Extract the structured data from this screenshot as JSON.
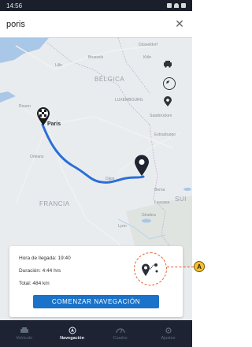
{
  "status_bar": {
    "time": "14:56"
  },
  "search": {
    "value": "poris",
    "close_icon": "close-icon"
  },
  "map": {
    "labels": {
      "dusseldorf": "Düsseldorf",
      "brussels": "Brussels",
      "koln": "Köln",
      "lille": "Lille",
      "belgica": "BÉLGICA",
      "luxembourg": "LUXEMBOURG",
      "saarbrucken": "Saarbrücken",
      "rouen": "Rouen",
      "paris": "Paris",
      "strasbourg": "Estrasburgo",
      "orleans": "Orléans",
      "dijon": "Dijon",
      "bern": "Berna",
      "francia": "FRANCIA",
      "lausanne": "Lausana",
      "geneva": "Ginebra",
      "lyon": "Lyon",
      "sui": "SUI"
    },
    "controls": [
      "car-icon",
      "compass-icon",
      "pin-icon"
    ]
  },
  "info_card": {
    "arrival": "Hora de llegada: 19:40",
    "duration": "Duración: 4:44 hrs",
    "total": "Total: 484 km",
    "start_button": "COMENZAR NAVEGACIÓN"
  },
  "bottom_nav": [
    {
      "label": "Vehículo",
      "icon": "car-icon",
      "active": false
    },
    {
      "label": "Navegación",
      "icon": "navigation-icon",
      "active": true
    },
    {
      "label": "Cuadro",
      "icon": "dashboard-icon",
      "active": false
    },
    {
      "label": "Ajustes",
      "icon": "settings-icon",
      "active": false
    }
  ],
  "callout": {
    "label": "A"
  },
  "colors": {
    "route": "#2b6fd6",
    "accent": "#1a73c9",
    "highlight": "#e45a28",
    "callout": "#f6c12f"
  }
}
